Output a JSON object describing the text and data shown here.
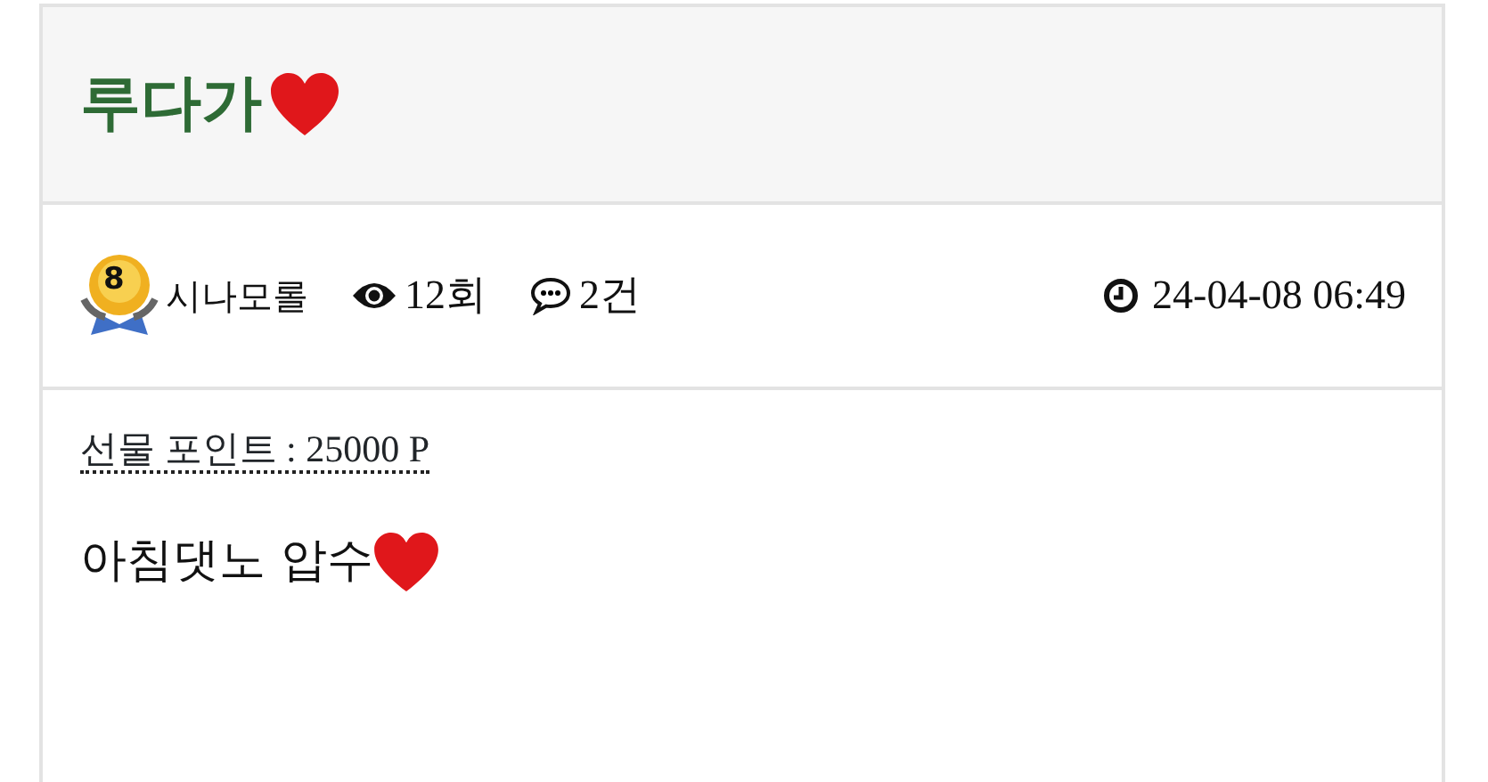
{
  "post": {
    "title": "루다가",
    "author": {
      "level": "8",
      "name": "시나모롤"
    },
    "views": "12회",
    "comments": "2건",
    "date": "24-04-08 06:49",
    "gift_points": "선물 포인트 : 25000 P",
    "body": "아침댓노 압수"
  }
}
